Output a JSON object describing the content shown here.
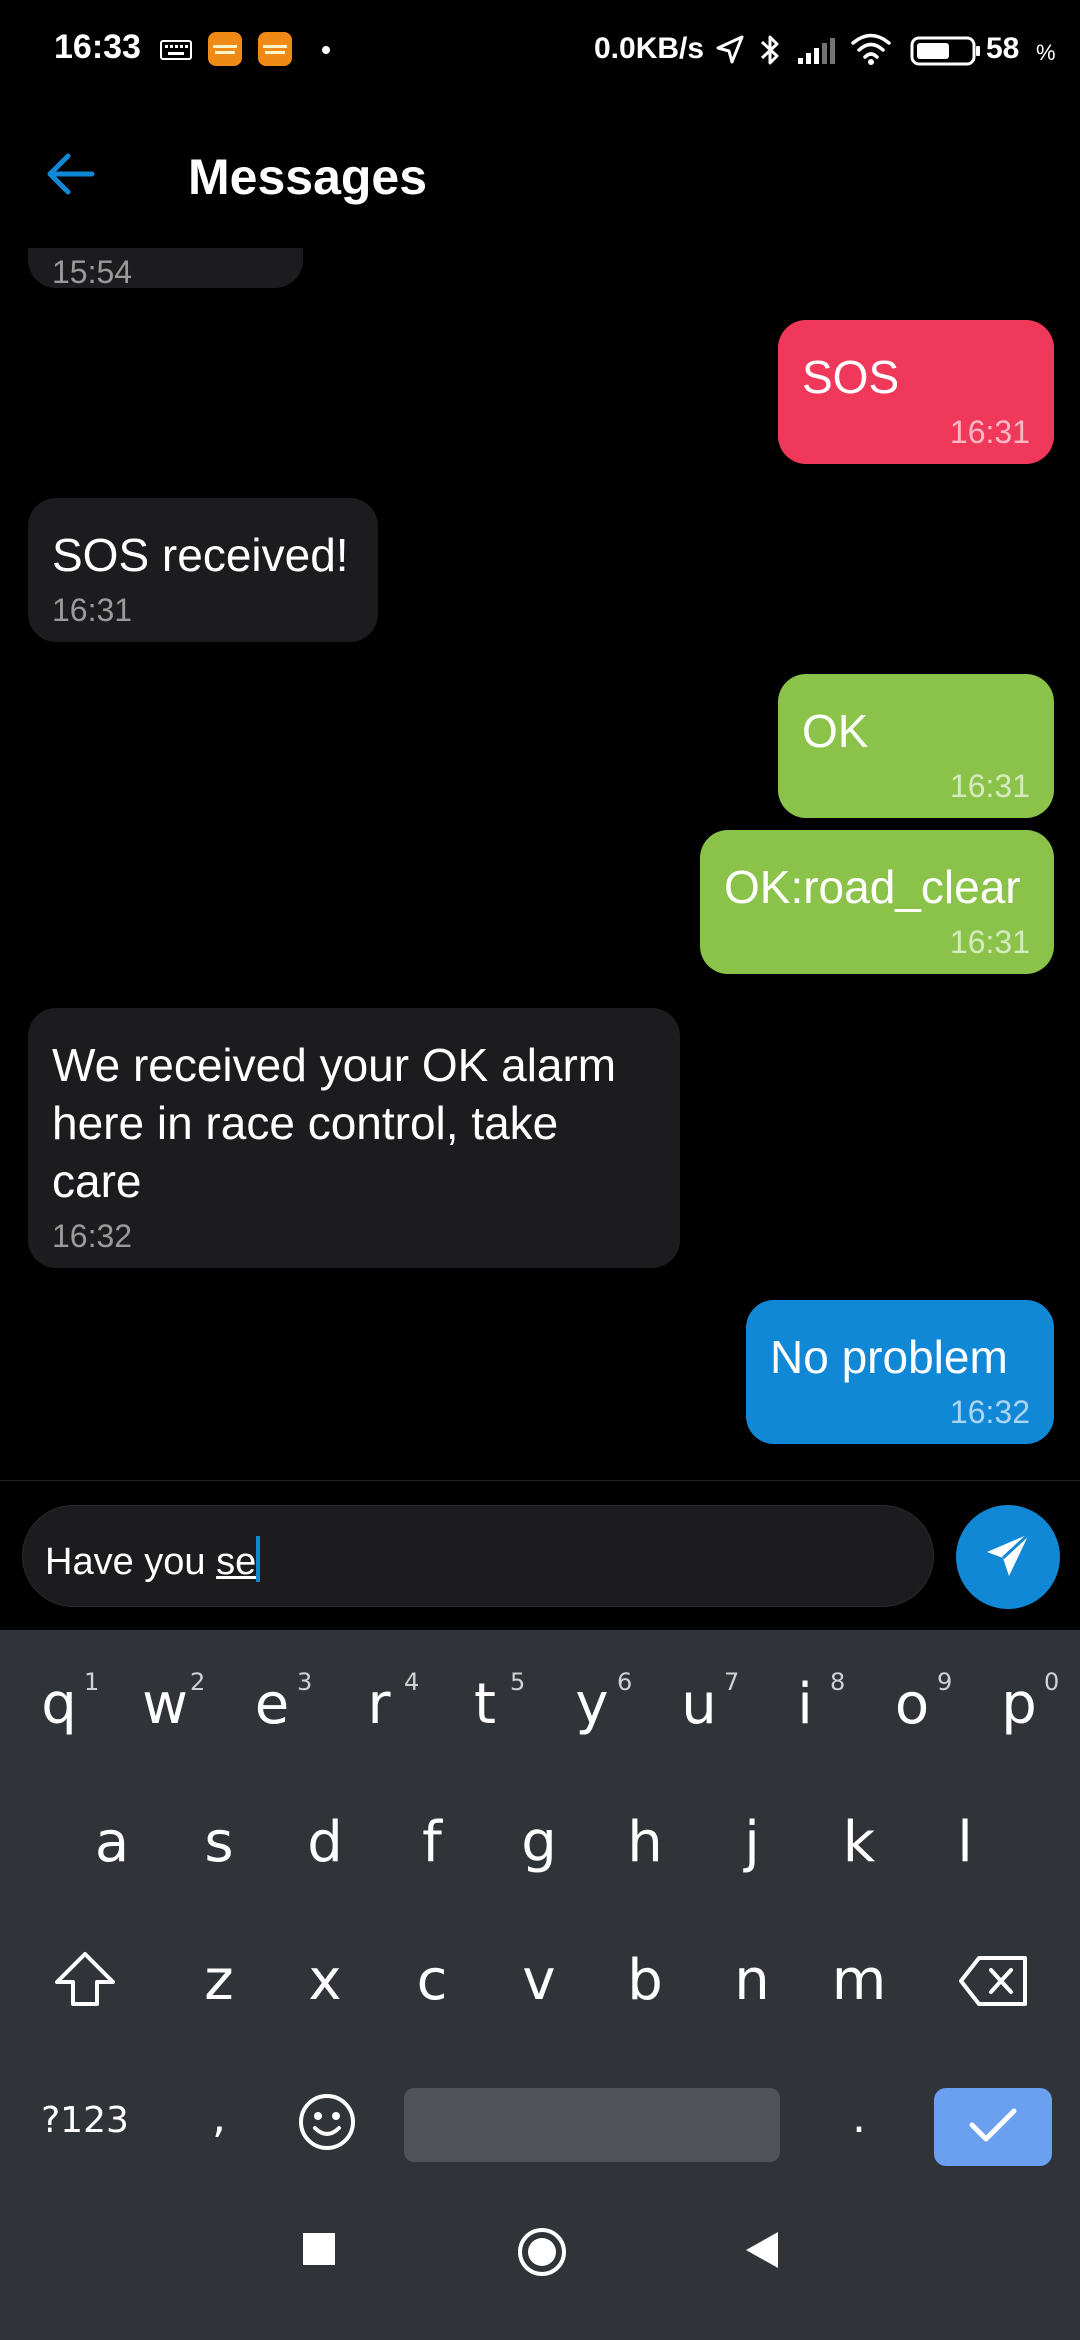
{
  "status_bar": {
    "time": "16:33",
    "net_speed": "0.0KB/s",
    "battery_level": "58",
    "battery_unit": "%",
    "icons": [
      "keyboard-icon",
      "app-notification-icon",
      "app-notification-icon",
      "dot-icon",
      "location-arrow-icon",
      "bluetooth-icon",
      "signal-icon",
      "wifi-icon",
      "battery-icon"
    ]
  },
  "app_bar": {
    "title": "Messages",
    "back_icon": "arrow-left-icon"
  },
  "colors": {
    "sos": "#f0385a",
    "ok": "#8bc34a",
    "sent": "#1188d6",
    "incoming": "#1c1c1e",
    "accent": "#1188d6"
  },
  "messages": [
    {
      "direction": "in",
      "text": "",
      "time": "15:54"
    },
    {
      "direction": "out",
      "text": "SOS",
      "time": "16:31",
      "color": "#f0385a"
    },
    {
      "direction": "in",
      "text": "SOS received!",
      "time": "16:31"
    },
    {
      "direction": "out",
      "text": "OK",
      "time": "16:31",
      "color": "#8bc34a"
    },
    {
      "direction": "out",
      "text": "OK:road_clear",
      "time": "16:31",
      "color": "#8bc34a"
    },
    {
      "direction": "in",
      "text_lines": [
        "We received your OK alarm",
        "here in race control, take",
        "care"
      ],
      "time": "16:32"
    },
    {
      "direction": "out",
      "text": "No problem",
      "time": "16:32",
      "color": "#1188d6"
    }
  ],
  "composer": {
    "text_before": "Have you ",
    "text_current_word": "se",
    "send_icon": "paper-plane-icon"
  },
  "keyboard": {
    "row1": [
      "q",
      "w",
      "e",
      "r",
      "t",
      "y",
      "u",
      "i",
      "o",
      "p"
    ],
    "row1_hints": [
      "1",
      "2",
      "3",
      "4",
      "5",
      "6",
      "7",
      "8",
      "9",
      "0"
    ],
    "row2": [
      "a",
      "s",
      "d",
      "f",
      "g",
      "h",
      "j",
      "k",
      "l"
    ],
    "row3": [
      "z",
      "x",
      "c",
      "v",
      "b",
      "n",
      "m"
    ],
    "symbols_key": "?123",
    "comma_key": ",",
    "period_key": ".",
    "icons": [
      "shift-icon",
      "backspace-icon",
      "emoji-icon",
      "checkmark-icon"
    ]
  },
  "nav_bar": {
    "icons": [
      "recents-square-icon",
      "home-circle-icon",
      "back-triangle-icon"
    ]
  }
}
